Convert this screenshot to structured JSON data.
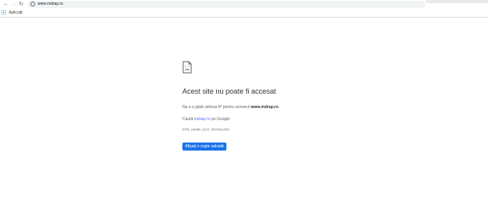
{
  "browser": {
    "url": "www.mdrap.ro",
    "bookmarks": {
      "apps_label": "Aplicații"
    }
  },
  "error": {
    "title": "Acest site nu poate fi accesat",
    "description_prefix": "Nu s-a găsit adresa IP pentru serverul",
    "description_host": "www.mdrap.ro",
    "description_suffix": ".",
    "search_prefix": "Caută",
    "search_link": "mdrap ro",
    "search_suffix": "pe Google",
    "code": "ERR_NAME_NOT_RESOLVED",
    "button_label": "Afișați o copie salvată"
  },
  "icons": {
    "back": "arrow-left-icon",
    "forward": "arrow-right-icon",
    "reload": "reload-icon",
    "info": "info-icon",
    "apps": "apps-grid-icon",
    "error": "sad-page-icon"
  },
  "colors": {
    "button": "#1a73e8",
    "link": "#4c6ef5",
    "omnibox": "#f1f3f4"
  }
}
